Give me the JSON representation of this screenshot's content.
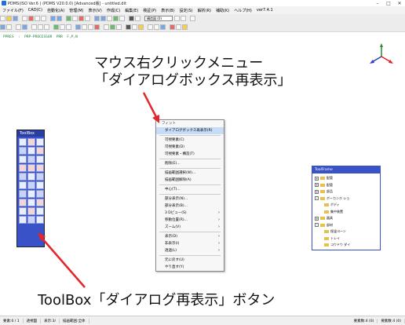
{
  "window": {
    "title": "PDMS(ISO Ver.6 ) (PDMS V20.0.0) [Advanced版] - untitled.dit"
  },
  "menubar": {
    "items": [
      "ファイル(F)",
      "CAD(C)",
      "自動化(A)",
      "管理(M)",
      "表示(V)",
      "作成(C)",
      "編集(E)",
      "検証(P)",
      "表示(B)",
      "設定(S)",
      "解析(R)",
      "補助(K)",
      "ヘルプ(H)",
      "ver7.4.1"
    ]
  },
  "toolbar": {
    "layer_combo": "構造図 (0)"
  },
  "command_line": "PPRES  :  PRP-PROCESSOR  PRR  F,P,N",
  "annotations": {
    "context_line1": "マウス右クリックメニュー",
    "context_line2": "「ダイアログボックス再表示」",
    "toolbox_caption": "ToolBox「ダイアログ再表示」ボタン"
  },
  "palette": {
    "title": "ToolBox"
  },
  "context_menu": {
    "items": [
      {
        "label": "フィット",
        "first": true
      },
      {
        "label": "ダイアログボックス再表示(R)",
        "highlight": true
      },
      {
        "sep": true
      },
      {
        "label": "可視要素(C)"
      },
      {
        "label": "可視要素(D)"
      },
      {
        "label": "可視要素・構造(T)"
      },
      {
        "sep": true
      },
      {
        "label": "削除(E)..."
      },
      {
        "sep": true
      },
      {
        "label": "描画範囲選択(W)..."
      },
      {
        "label": "描画範囲解除(A)"
      },
      {
        "sep": true
      },
      {
        "label": "中心(T)..."
      },
      {
        "sep": true
      },
      {
        "label": "部分表示(N)..."
      },
      {
        "label": "部分表示(B)..."
      },
      {
        "label": "3 Dビュー(S)",
        "sub": true
      },
      {
        "label": "移動位置(R)...",
        "sub": true
      },
      {
        "label": "ズーム(V)",
        "sub": true
      },
      {
        "sep": true
      },
      {
        "label": "表示(D)",
        "sub": true
      },
      {
        "label": "非表示(I)",
        "sub": true
      },
      {
        "label": "透過(L)",
        "sub": true
      },
      {
        "sep": true
      },
      {
        "label": "元に戻す(U)"
      },
      {
        "label": "やり直す(Y)"
      }
    ]
  },
  "toolbox_tree": {
    "title": "ToolFrame",
    "items": [
      {
        "label": "配管",
        "level": 0,
        "expand": "+"
      },
      {
        "label": "配管",
        "level": 0,
        "expand": "+"
      },
      {
        "label": "部品",
        "level": 0,
        "expand": "+"
      },
      {
        "label": "ボーカンホ ショ",
        "level": 0,
        "expand": "-"
      },
      {
        "label": "ボディ",
        "level": 1
      },
      {
        "label": "集中装置",
        "level": 1
      },
      {
        "label": "器具",
        "level": 0,
        "expand": "+"
      },
      {
        "label": "部材",
        "level": 0,
        "expand": "-"
      },
      {
        "label": "保温ヨーン",
        "level": 1
      },
      {
        "label": "トレイ",
        "level": 1
      },
      {
        "label": "コウドウ ダイ",
        "level": 1
      }
    ]
  },
  "statusbar": {
    "cells": [
      "要素:0 / 1",
      "透視図",
      "表示:3/",
      "描画範囲:全体"
    ],
    "right_cells": [
      "要素数:4 (0)",
      "要素数:4 (0)"
    ]
  },
  "colors": {
    "annotation_arrow": "#e4262a",
    "palette_blue": "#3a52c8",
    "menu_highlight": "#c6dcf7"
  }
}
